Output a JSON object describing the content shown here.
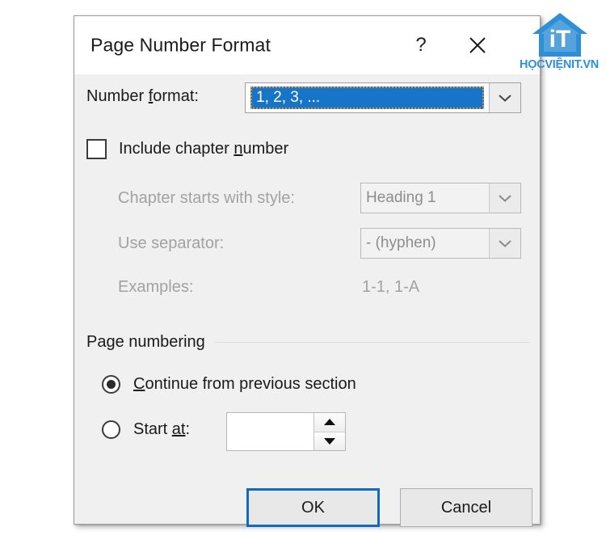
{
  "dialog": {
    "title": "Page Number Format",
    "help_icon": "question-mark-icon",
    "close_icon": "close-icon"
  },
  "number_format": {
    "label": "Number format:",
    "label_accelerator": "f",
    "selected_value": "1, 2, 3, ...",
    "dropdown_icon": "chevron-down-icon"
  },
  "include_chapter": {
    "label": "Include chapter number",
    "label_accelerator": "n",
    "checked": false
  },
  "chapter_style": {
    "label": "Chapter starts with style:",
    "selected_value": "Heading 1",
    "dropdown_icon": "chevron-down-icon",
    "disabled": true
  },
  "separator": {
    "label": "Use separator:",
    "selected_value": "-   (hyphen)",
    "dropdown_icon": "chevron-down-icon",
    "disabled": true
  },
  "examples": {
    "label": "Examples:",
    "value": "1-1, 1-A",
    "disabled": true
  },
  "page_numbering": {
    "group_label": "Page numbering",
    "continue_option": {
      "label": "Continue from previous section",
      "label_accelerator": "C",
      "selected": true
    },
    "start_at_option": {
      "label": "Start at:",
      "label_accelerator": "at",
      "selected": false,
      "value": "",
      "spinner_up_icon": "triangle-up-icon",
      "spinner_down_icon": "triangle-down-icon"
    }
  },
  "buttons": {
    "ok": "OK",
    "cancel": "Cancel"
  },
  "watermark": {
    "brand_letters": "iT",
    "brand_text": "HỌCVIỆNIT.VN",
    "brand_color": "#2f8fd6"
  },
  "colors": {
    "accent": "#0f6cbd",
    "selection": "#1675c8",
    "focus_outline": "#e8912a",
    "dialog_background": "#f0f0f0",
    "titlebar_background": "#ffffff",
    "disabled_text": "#a2a2a2"
  }
}
